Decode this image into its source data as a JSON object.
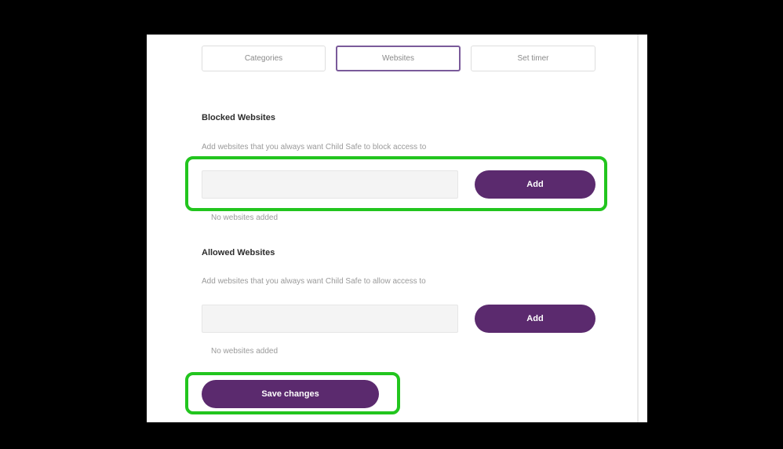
{
  "tabs": [
    {
      "label": "Categories",
      "active": false
    },
    {
      "label": "Websites",
      "active": true
    },
    {
      "label": "Set timer",
      "active": false
    }
  ],
  "blocked": {
    "title": "Blocked Websites",
    "hint": "Add websites that you always want Child Safe to block access to",
    "input_value": "",
    "add_label": "Add",
    "empty_note": "No websites added"
  },
  "allowed": {
    "title": "Allowed Websites",
    "hint": "Add websites that you always want Child Safe to allow access to",
    "input_value": "",
    "add_label": "Add",
    "empty_note": "No websites added"
  },
  "save_label": "Save changes",
  "colors": {
    "accent": "#5b2a6e",
    "active_tab_border": "#7a5a9a",
    "highlight": "#22c51e"
  }
}
